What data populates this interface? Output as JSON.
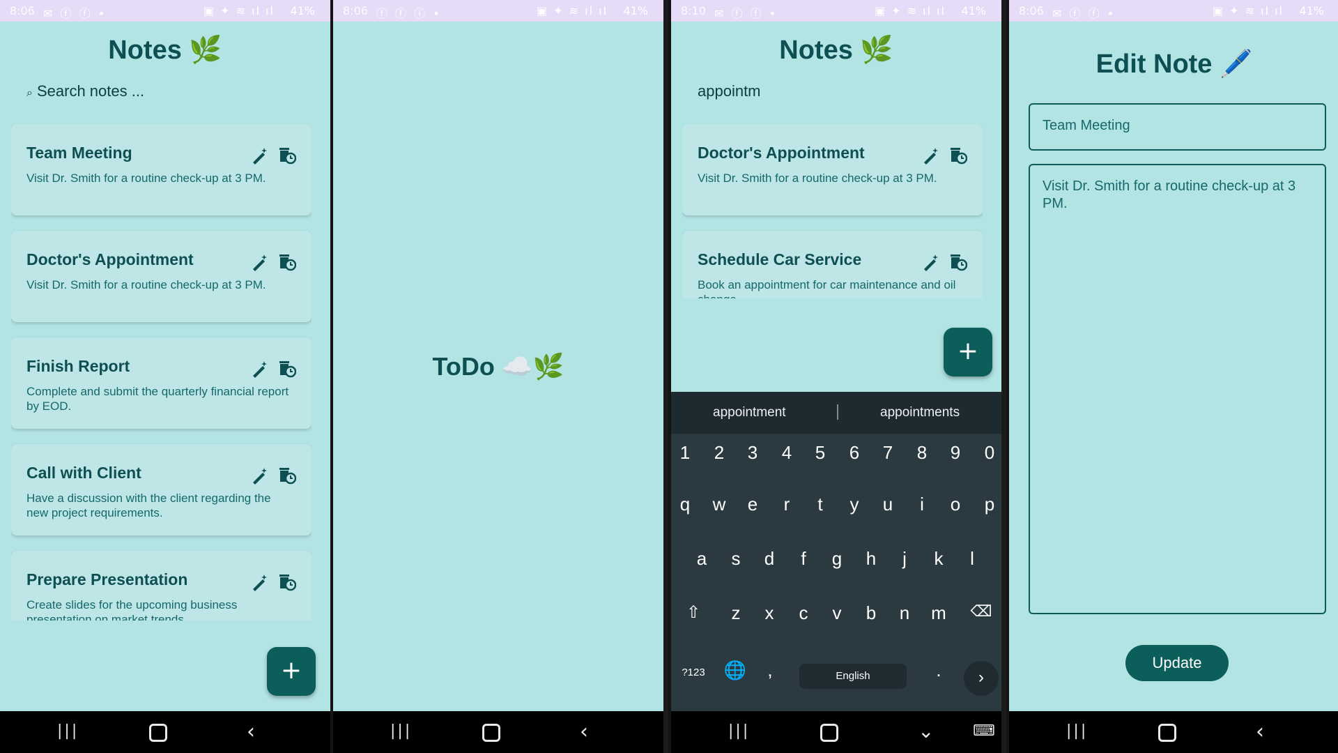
{
  "panels": {
    "p1": {
      "status_time": "8:06",
      "status_batt": "41%",
      "title": "Notes 🌿",
      "search_placeholder": "Search notes ...",
      "notes": [
        {
          "title": "Team Meeting",
          "body": "Visit Dr. Smith for a routine check-up at 3 PM."
        },
        {
          "title": "Doctor's Appointment",
          "body": "Visit Dr. Smith for a routine check-up at 3 PM."
        },
        {
          "title": "Finish Report",
          "body": "Complete and submit the quarterly financial report by EOD."
        },
        {
          "title": "Call with Client",
          "body": "Have a discussion with the client regarding the new project requirements."
        },
        {
          "title": "Prepare Presentation",
          "body": "Create slides for the upcoming business presentation on market trends."
        }
      ],
      "fab": "+"
    },
    "p2": {
      "status_time": "8:06",
      "status_batt": "41%",
      "splash_text": "ToDo ☁️🌿"
    },
    "p3": {
      "status_time": "8:10",
      "status_batt": "41%",
      "title": "Notes 🌿",
      "search_value": "appointm",
      "notes": [
        {
          "title": "Doctor's Appointment",
          "body": "Visit Dr. Smith for a routine check-up at 3 PM."
        },
        {
          "title": "Schedule Car Service",
          "body": "Book an appointment for car maintenance and oil change."
        }
      ],
      "fab": "+",
      "keyboard": {
        "suggestions": [
          "appointment",
          "appointments"
        ],
        "row_numbers": [
          "1",
          "2",
          "3",
          "4",
          "5",
          "6",
          "7",
          "8",
          "9",
          "0"
        ],
        "row_q": [
          "q",
          "w",
          "e",
          "r",
          "t",
          "y",
          "u",
          "i",
          "o",
          "p"
        ],
        "row_a": [
          "a",
          "s",
          "d",
          "f",
          "g",
          "h",
          "j",
          "k",
          "l"
        ],
        "row_z": [
          "z",
          "x",
          "c",
          "v",
          "b",
          "n",
          "m"
        ],
        "symbols_key": "?123",
        "comma": ",",
        "space_label": "English",
        "period": ".",
        "enter": "›"
      }
    },
    "p4": {
      "status_time": "8:06",
      "status_batt": "41%",
      "title": "Edit Note 🖊️",
      "title_value": "Team Meeting",
      "body_value": "Visit Dr. Smith for a routine check-up at 3 PM.",
      "update_label": "Update"
    }
  },
  "colors": {
    "accent": "#0b5e59",
    "background": "#b2e4e4",
    "text_dark": "#0d4f52",
    "card": "#bfe6e6"
  }
}
